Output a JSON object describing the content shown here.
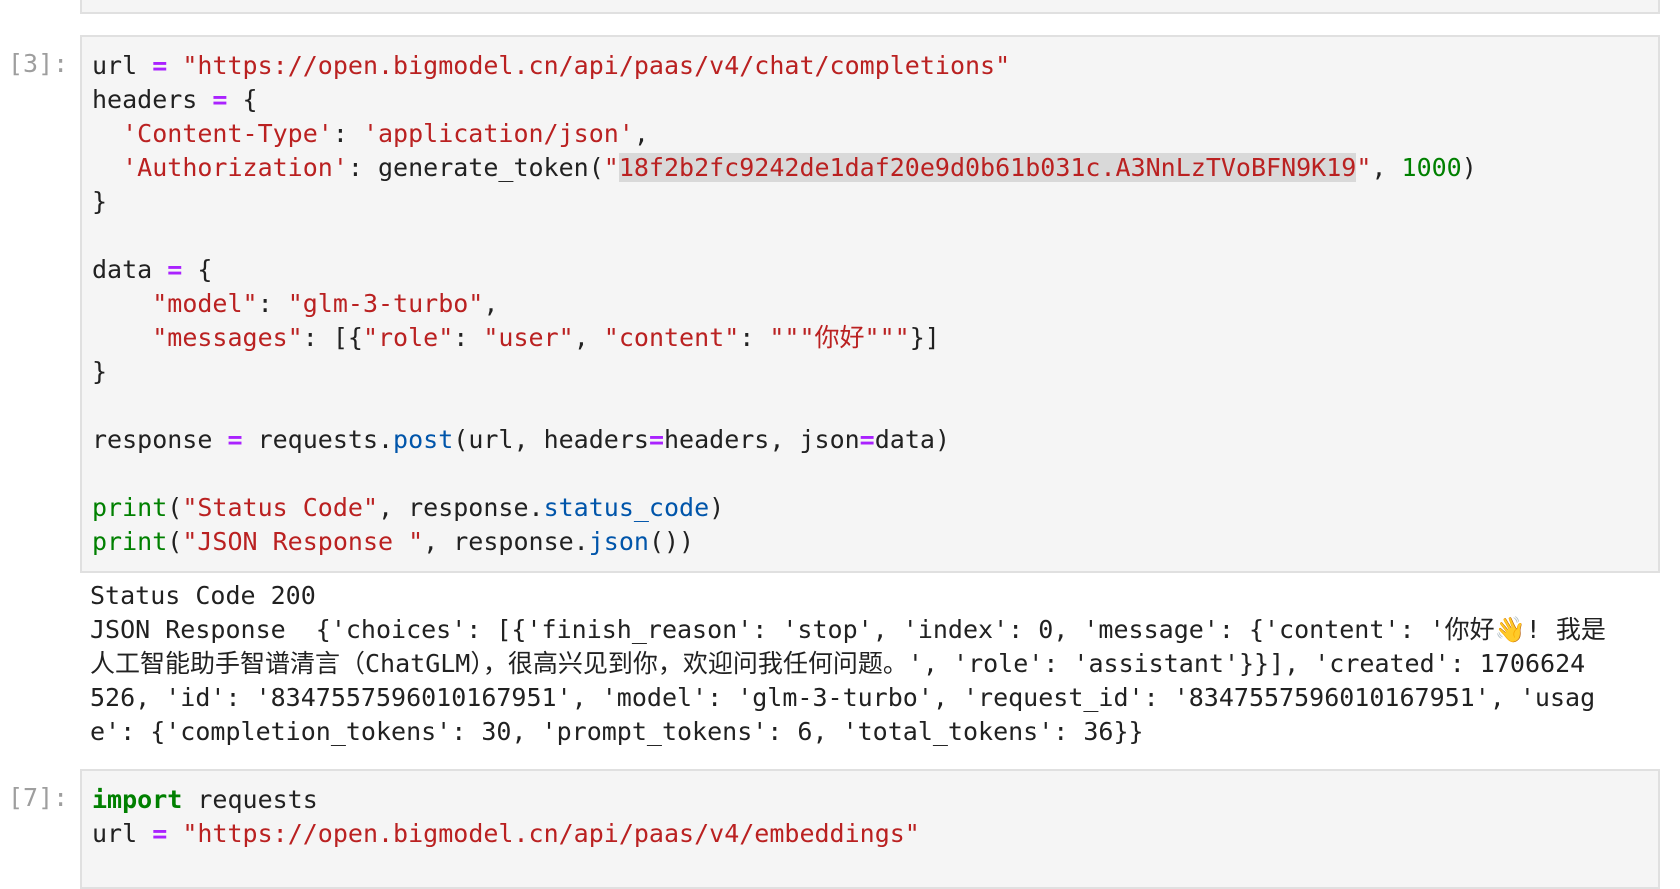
{
  "cells": [
    {
      "prompt": "[3]:",
      "code": [
        [
          [
            "url ",
            ""
          ],
          [
            "=",
            "o"
          ],
          [
            " ",
            ""
          ],
          [
            "\"https://open.bigmodel.cn/api/paas/v4/chat/completions\"",
            "s"
          ]
        ],
        [
          [
            "headers ",
            ""
          ],
          [
            "=",
            "o"
          ],
          [
            " {",
            ""
          ]
        ],
        [
          [
            "  ",
            ""
          ],
          [
            "'Content-Type'",
            "s"
          ],
          [
            ": ",
            ""
          ],
          [
            "'application/json'",
            "s"
          ],
          [
            ",",
            ""
          ]
        ],
        [
          [
            "  ",
            ""
          ],
          [
            "'Authorization'",
            "s"
          ],
          [
            ": generate_token(",
            ""
          ],
          [
            "\"",
            "s"
          ],
          [
            "18f2b2fc9242de1daf20e9d0b61b031c.A3NnLzTVoBFN9K19",
            "s hl"
          ],
          [
            "\"",
            "s"
          ],
          [
            ", ",
            ""
          ],
          [
            "1000",
            "n"
          ],
          [
            ")",
            ""
          ]
        ],
        [
          [
            "}",
            ""
          ]
        ],
        [],
        [
          [
            "data ",
            ""
          ],
          [
            "=",
            "o"
          ],
          [
            " {",
            ""
          ]
        ],
        [
          [
            "    ",
            ""
          ],
          [
            "\"model\"",
            "s"
          ],
          [
            ": ",
            ""
          ],
          [
            "\"glm-3-turbo\"",
            "s"
          ],
          [
            ",",
            ""
          ]
        ],
        [
          [
            "    ",
            ""
          ],
          [
            "\"messages\"",
            "s"
          ],
          [
            ": [{",
            ""
          ],
          [
            "\"role\"",
            "s"
          ],
          [
            ": ",
            ""
          ],
          [
            "\"user\"",
            "s"
          ],
          [
            ", ",
            ""
          ],
          [
            "\"content\"",
            "s"
          ],
          [
            ": ",
            ""
          ],
          [
            "\"\"\"你好\"\"\"",
            "s"
          ],
          [
            "}]",
            ""
          ]
        ],
        [
          [
            "}",
            ""
          ]
        ],
        [],
        [
          [
            "response ",
            ""
          ],
          [
            "=",
            "o"
          ],
          [
            " requests.",
            ""
          ],
          [
            "post",
            "a"
          ],
          [
            "(url, headers",
            ""
          ],
          [
            "=",
            "o"
          ],
          [
            "headers, json",
            ""
          ],
          [
            "=",
            "o"
          ],
          [
            "data)",
            ""
          ]
        ],
        [],
        [
          [
            "print",
            "b"
          ],
          [
            "(",
            ""
          ],
          [
            "\"Status Code\"",
            "s"
          ],
          [
            ", response.",
            ""
          ],
          [
            "status_code",
            "a"
          ],
          [
            ")",
            ""
          ]
        ],
        [
          [
            "print",
            "b"
          ],
          [
            "(",
            ""
          ],
          [
            "\"JSON Response \"",
            "s"
          ],
          [
            ", response.",
            ""
          ],
          [
            "json",
            "a"
          ],
          [
            "())",
            ""
          ]
        ]
      ],
      "output": [
        "Status Code 200",
        "JSON Response  {'choices': [{'finish_reason': 'stop', 'index': 0, 'message': {'content': '你好👋! 我是",
        "人工智能助手智谱清言（ChatGLM），很高兴见到你，欢迎问我任何问题。', 'role': 'assistant'}}], 'created': 1706624",
        "526, 'id': '8347557596010167951', 'model': 'glm-3-turbo', 'request_id': '8347557596010167951', 'usag",
        "e': {'completion_tokens': 30, 'prompt_tokens': 6, 'total_tokens': 36}}"
      ]
    },
    {
      "prompt": "[7]:",
      "code": [
        [
          [
            "import",
            "k"
          ],
          [
            " requests",
            ""
          ]
        ],
        [
          [
            "url ",
            ""
          ],
          [
            "=",
            "o"
          ],
          [
            " ",
            ""
          ],
          [
            "\"https://open.bigmodel.cn/api/paas/v4/embeddings\"",
            "s"
          ]
        ]
      ]
    }
  ]
}
